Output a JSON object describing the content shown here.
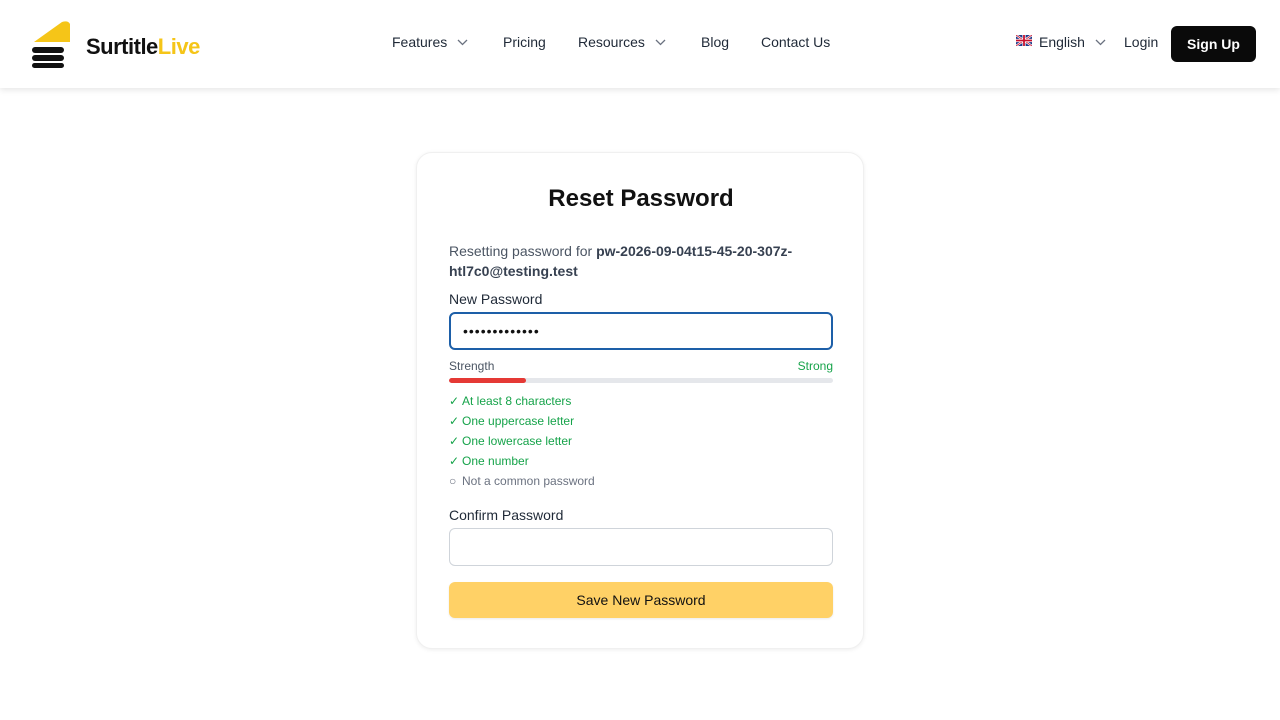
{
  "brand": {
    "name_primary": "Surtitle",
    "name_accent": "Live",
    "accent_color": "#f5c518"
  },
  "nav": {
    "items": [
      {
        "label": "Features",
        "dropdown": true
      },
      {
        "label": "Pricing",
        "dropdown": false
      },
      {
        "label": "Resources",
        "dropdown": true
      },
      {
        "label": "Blog",
        "dropdown": false
      },
      {
        "label": "Contact Us",
        "dropdown": false
      }
    ]
  },
  "header_right": {
    "language": {
      "label": "English",
      "flag_icon": "uk-flag-icon"
    },
    "login_label": "Login",
    "signup_label": "Sign Up"
  },
  "form": {
    "title": "Reset Password",
    "reset_prefix": "Resetting password for ",
    "email": "pw-2026-09-04t15-45-20-307z-htl7c0@testing.test",
    "new_password": {
      "label": "New Password",
      "value": "•••••••••••••"
    },
    "strength": {
      "label": "Strength",
      "value": "Strong",
      "fraction": 0.2,
      "value_color": "#16a34a",
      "bar_color": "#e53935"
    },
    "requirements": [
      {
        "icon": "✓",
        "text": "At least 8 characters",
        "met": true
      },
      {
        "icon": "✓",
        "text": "One uppercase letter",
        "met": true
      },
      {
        "icon": "✓",
        "text": "One lowercase letter",
        "met": true
      },
      {
        "icon": "✓",
        "text": "One number",
        "met": true
      },
      {
        "icon": "○",
        "text": "Not a common password",
        "met": false
      }
    ],
    "confirm_password": {
      "label": "Confirm Password",
      "value": ""
    },
    "save_label": "Save New Password",
    "save_color": "#ffd166"
  }
}
